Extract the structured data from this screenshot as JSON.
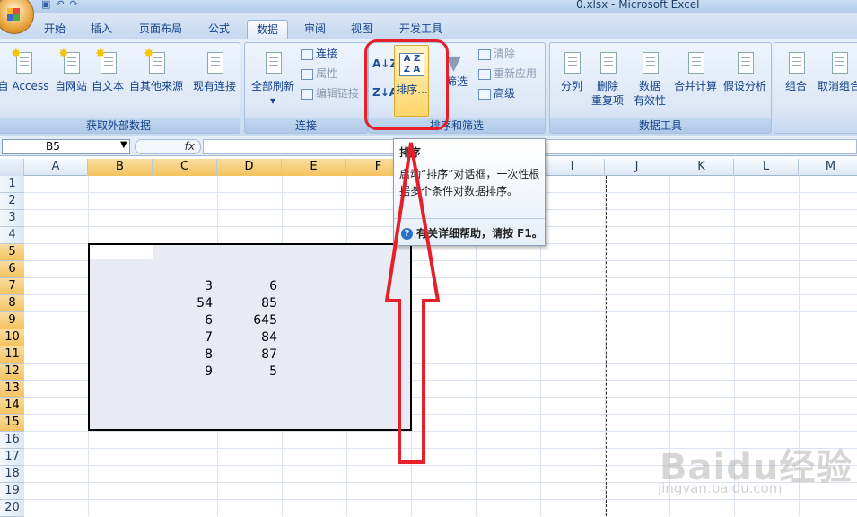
{
  "window": {
    "title": "0.xlsx - Microsoft Excel"
  },
  "tabs": [
    {
      "label": "开始"
    },
    {
      "label": "插入"
    },
    {
      "label": "页面布局"
    },
    {
      "label": "公式"
    },
    {
      "label": "数据",
      "active": true
    },
    {
      "label": "审阅"
    },
    {
      "label": "视图"
    },
    {
      "label": "开发工具"
    }
  ],
  "groups": {
    "external": {
      "label": "获取外部数据",
      "buttons": [
        {
          "label": "自 Access"
        },
        {
          "label": "自网站"
        },
        {
          "label": "自文本"
        },
        {
          "label": "自其他来源"
        },
        {
          "label": "现有连接"
        }
      ]
    },
    "connections": {
      "label": "连接",
      "refresh_label": "全部刷新",
      "connect_label": "连接",
      "properties_label": "属性",
      "edit_links_label": "编辑链接"
    },
    "sortfilter": {
      "label": "排序和筛选",
      "sort_label": "排序...",
      "filter_label": "筛选",
      "clear_label": "清除",
      "reapply_label": "重新应用",
      "advanced_label": "高级"
    },
    "datatools": {
      "label": "数据工具",
      "buttons": [
        {
          "label": "分列"
        },
        {
          "label": "删除",
          "label2": "重复项"
        },
        {
          "label": "数据",
          "label2": "有效性"
        },
        {
          "label": "合并计算"
        },
        {
          "label": "假设分析"
        }
      ]
    },
    "outline": {
      "buttons": [
        {
          "label": "组合"
        },
        {
          "label": "取消组合"
        }
      ]
    }
  },
  "formula_bar": {
    "name_box": "B5",
    "fx": "fx",
    "formula": ""
  },
  "columns": [
    "A",
    "B",
    "C",
    "D",
    "E",
    "F",
    "G",
    "H",
    "I",
    "J",
    "K",
    "L",
    "M"
  ],
  "rows": [
    "1",
    "2",
    "3",
    "4",
    "5",
    "6",
    "7",
    "8",
    "9",
    "10",
    "11",
    "12",
    "13",
    "14",
    "15",
    "16",
    "17",
    "18",
    "19",
    "20"
  ],
  "cells": {
    "C": [
      "3",
      "54",
      "6",
      "7",
      "8",
      "9"
    ],
    "D": [
      "6",
      "85",
      "645",
      "84",
      "87",
      "5"
    ]
  },
  "tooltip": {
    "title": "排序",
    "body": "启动“排序”对话框，一次性根据多个条件对数据排序。",
    "help": "有关详细帮助，请按 F1。"
  },
  "watermark": {
    "logo": "Baidu经验",
    "url": "jingyan.baidu.com"
  },
  "colors": {
    "annotation": "#e5202a",
    "selection_fill": "#e8eaf4",
    "ribbon": "#d8e5f5"
  }
}
